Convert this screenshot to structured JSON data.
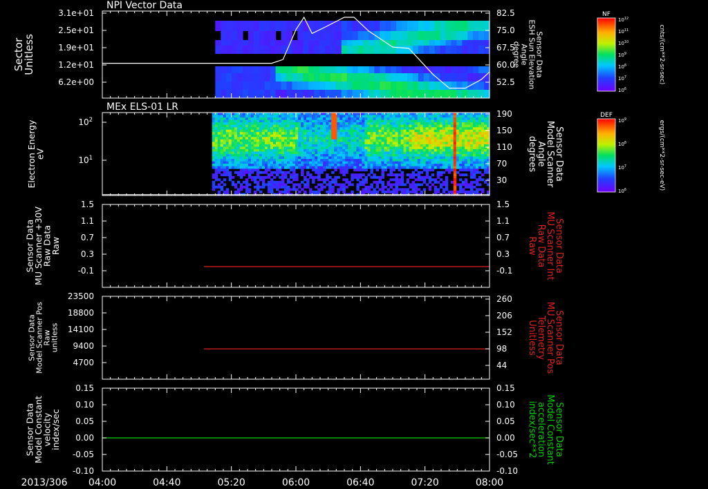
{
  "time_axis": {
    "date_label": "2013/306",
    "ticks": [
      "04:00",
      "04:40",
      "05:20",
      "06:00",
      "06:40",
      "07:20",
      "08:00"
    ],
    "range_minutes": [
      240,
      480
    ]
  },
  "colors": {
    "background": "#000000",
    "axis": "#ffffff",
    "red_series": "#e02020",
    "green_series": "#00d000"
  },
  "chart_data": [
    {
      "type": "heatmap",
      "title": "NPI Vector Data",
      "ylabel": "Sector\nUnitless",
      "y_ticks": [
        "3.1e+01",
        "2.5e+01",
        "1.9e+01",
        "1.2e+01",
        "6.2e+00"
      ],
      "right_ylabel": "Sensor Data\nESH Sun Elevation\nAngle\ndegree",
      "right_ticks": [
        "82.5",
        "75.0",
        "67.5",
        "60.0",
        "52.5"
      ],
      "right_ylim": [
        47.5,
        82.5
      ],
      "data_start": "05:10",
      "overlay_line": {
        "name": "ESH Sun Elevation Angle",
        "color": "#ffffff",
        "x": [
          "04:00",
          "05:45",
          "05:52",
          "06:00",
          "06:05",
          "06:10",
          "06:18",
          "06:30",
          "06:36",
          "06:45",
          "07:00",
          "07:10",
          "07:25",
          "07:35",
          "07:45",
          "07:55",
          "08:00"
        ],
        "y": [
          61.5,
          61.5,
          63,
          75,
          80,
          73.5,
          76,
          80,
          80,
          74.5,
          68,
          67.5,
          57,
          51.5,
          51.5,
          55,
          58
        ]
      },
      "colorbar": {
        "label": "NF",
        "ticks": [
          "10^12",
          "10^11",
          "10^10",
          "10^9",
          "10^8",
          "10^7",
          "10^6"
        ],
        "units": "cnts/(cm**2-sr-sec)"
      }
    },
    {
      "type": "heatmap",
      "title": "MEx ELS-01 LR",
      "ylabel": "Electron Energy\neV",
      "y_ticks": [
        "10^2",
        "10^1"
      ],
      "right_ylabel": "Sensor Data\nModel Scanner\nAngle\ndegrees",
      "right_ticks": [
        "190",
        "150",
        "110",
        "70",
        "30"
      ],
      "right_ylim": [
        10,
        190
      ],
      "data_start": "05:08",
      "overlay_line": {
        "name": "Model Scanner Angle",
        "color": "#ffffff",
        "x": [
          "04:00",
          "08:00"
        ],
        "y": [
          12,
          12
        ]
      },
      "colorbar": {
        "label": "DEF",
        "ticks": [
          "10^9",
          "10^8",
          "10^7",
          "10^6"
        ],
        "units": "ergs/(cm**2-sr-sec-eV)"
      }
    },
    {
      "type": "line",
      "ylabel": "Sensor Data\nMU Scanner +30V\nRaw Data\nRaw",
      "y_ticks": [
        "1.5",
        "1.1",
        "0.7",
        "0.3",
        "-0.1"
      ],
      "ylim": [
        -0.5,
        1.5
      ],
      "right_ylabel": "Sensor Data\nMU Scanner Int\nRaw Data\nRaw",
      "right_ticks": [
        "1.5",
        "1.1",
        "0.7",
        "0.3",
        "-0.1"
      ],
      "right_label_color": "#e02020",
      "series": [
        {
          "x": [
            "05:03",
            "08:00"
          ],
          "values": [
            0.0,
            0.0
          ],
          "color": "#e02020"
        }
      ]
    },
    {
      "type": "line",
      "ylabel": "Sensor Data\nModel Scanner Pos\nRaw\nunitless",
      "y_ticks": [
        "23500",
        "18800",
        "14100",
        "9400",
        "4700"
      ],
      "ylim": [
        0,
        23500
      ],
      "right_ylabel": "Sensor Data\nMU Scanner Pos\nTelemetry\nUnitless",
      "right_ticks": [
        "260",
        "206",
        "152",
        "98",
        "44"
      ],
      "right_label_color": "#e02020",
      "series": [
        {
          "x": [
            "05:03",
            "08:00"
          ],
          "values": [
            8600,
            8600
          ],
          "color": "#e02020"
        }
      ]
    },
    {
      "type": "line",
      "ylabel": "Sensor Data\nModel Constant\nvelocity\nindex/sec",
      "y_ticks": [
        "0.15",
        "0.10",
        "0.05",
        "0.00",
        "-0.05",
        "-0.10"
      ],
      "ylim": [
        -0.1,
        0.15
      ],
      "right_ylabel": "Sensor Data\nModel Constant\nacceleration\nindex/sec**2",
      "right_ticks": [
        "0.15",
        "0.10",
        "0.05",
        "0.00",
        "-0.05",
        "-0.10"
      ],
      "right_label_color": "#00d000",
      "series": [
        {
          "x": [
            "04:00",
            "08:00"
          ],
          "values": [
            0.0,
            0.0
          ],
          "color": "#00d000"
        }
      ]
    }
  ]
}
